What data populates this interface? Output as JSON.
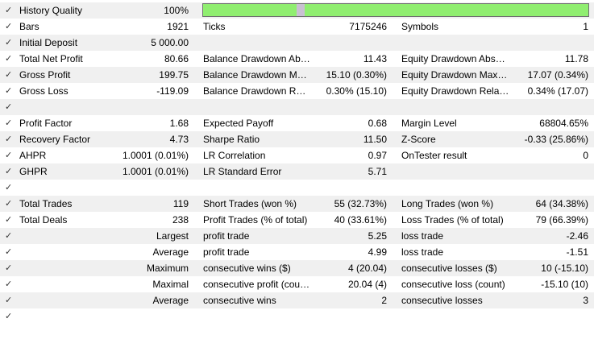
{
  "colors": {
    "quality_bar": "#90ee70",
    "quality_marker": "#c9c0d2",
    "row_shade": "#f0f0f0"
  },
  "history_quality": {
    "label": "History Quality",
    "value": "100%",
    "level": 1.0
  },
  "rows": [
    {
      "c1": "Bars",
      "c2": "1921",
      "c3": "Ticks",
      "c4": "7175246",
      "c5": "Symbols",
      "c6": "1"
    },
    {
      "c1": "Initial Deposit",
      "c2": "5 000.00",
      "c3": "",
      "c4": "",
      "c5": "",
      "c6": ""
    },
    {
      "c1": "Total Net Profit",
      "c2": "80.66",
      "c3": "Balance Drawdown Absolute",
      "c4": "11.43",
      "c5": "Equity Drawdown Absolute",
      "c6": "11.78"
    },
    {
      "c1": "Gross Profit",
      "c2": "199.75",
      "c3": "Balance Drawdown Maximal",
      "c4": "15.10 (0.30%)",
      "c5": "Equity Drawdown Maximal",
      "c6": "17.07 (0.34%)"
    },
    {
      "c1": "Gross Loss",
      "c2": "-119.09",
      "c3": "Balance Drawdown Relative",
      "c4": "0.30% (15.10)",
      "c5": "Equity Drawdown Relative",
      "c6": "0.34% (17.07)"
    },
    {
      "c1": "",
      "c2": "",
      "c3": "",
      "c4": "",
      "c5": "",
      "c6": ""
    },
    {
      "c1": "Profit Factor",
      "c2": "1.68",
      "c3": "Expected Payoff",
      "c4": "0.68",
      "c5": "Margin Level",
      "c6": "68804.65%"
    },
    {
      "c1": "Recovery Factor",
      "c2": "4.73",
      "c3": "Sharpe Ratio",
      "c4": "11.50",
      "c5": "Z-Score",
      "c6": "-0.33 (25.86%)"
    },
    {
      "c1": "AHPR",
      "c2": "1.0001 (0.01%)",
      "c3": "LR Correlation",
      "c4": "0.97",
      "c5": "OnTester result",
      "c6": "0"
    },
    {
      "c1": "GHPR",
      "c2": "1.0001 (0.01%)",
      "c3": "LR Standard Error",
      "c4": "5.71",
      "c5": "",
      "c6": ""
    },
    {
      "c1": "",
      "c2": "",
      "c3": "",
      "c4": "",
      "c5": "",
      "c6": ""
    },
    {
      "c1": "Total Trades",
      "c2": "119",
      "c3": "Short Trades (won %)",
      "c4": "55 (32.73%)",
      "c5": "Long Trades (won %)",
      "c6": "64 (34.38%)"
    },
    {
      "c1": "Total Deals",
      "c2": "238",
      "c3": "Profit Trades (% of total)",
      "c4": "40 (33.61%)",
      "c5": "Loss Trades (% of total)",
      "c6": "79 (66.39%)"
    },
    {
      "c1": "",
      "c2": "Largest",
      "c3": "profit trade",
      "c4": "5.25",
      "c5": "loss trade",
      "c6": "-2.46"
    },
    {
      "c1": "",
      "c2": "Average",
      "c3": "profit trade",
      "c4": "4.99",
      "c5": "loss trade",
      "c6": "-1.51"
    },
    {
      "c1": "",
      "c2": "Maximum",
      "c3": "consecutive wins ($)",
      "c4": "4 (20.04)",
      "c5": "consecutive losses ($)",
      "c6": "10 (-15.10)"
    },
    {
      "c1": "",
      "c2": "Maximal",
      "c3": "consecutive profit (count)",
      "c4": "20.04 (4)",
      "c5": "consecutive loss (count)",
      "c6": "-15.10 (10)"
    },
    {
      "c1": "",
      "c2": "Average",
      "c3": "consecutive wins",
      "c4": "2",
      "c5": "consecutive losses",
      "c6": "3"
    },
    {
      "c1": "",
      "c2": "",
      "c3": "",
      "c4": "",
      "c5": "",
      "c6": ""
    }
  ]
}
